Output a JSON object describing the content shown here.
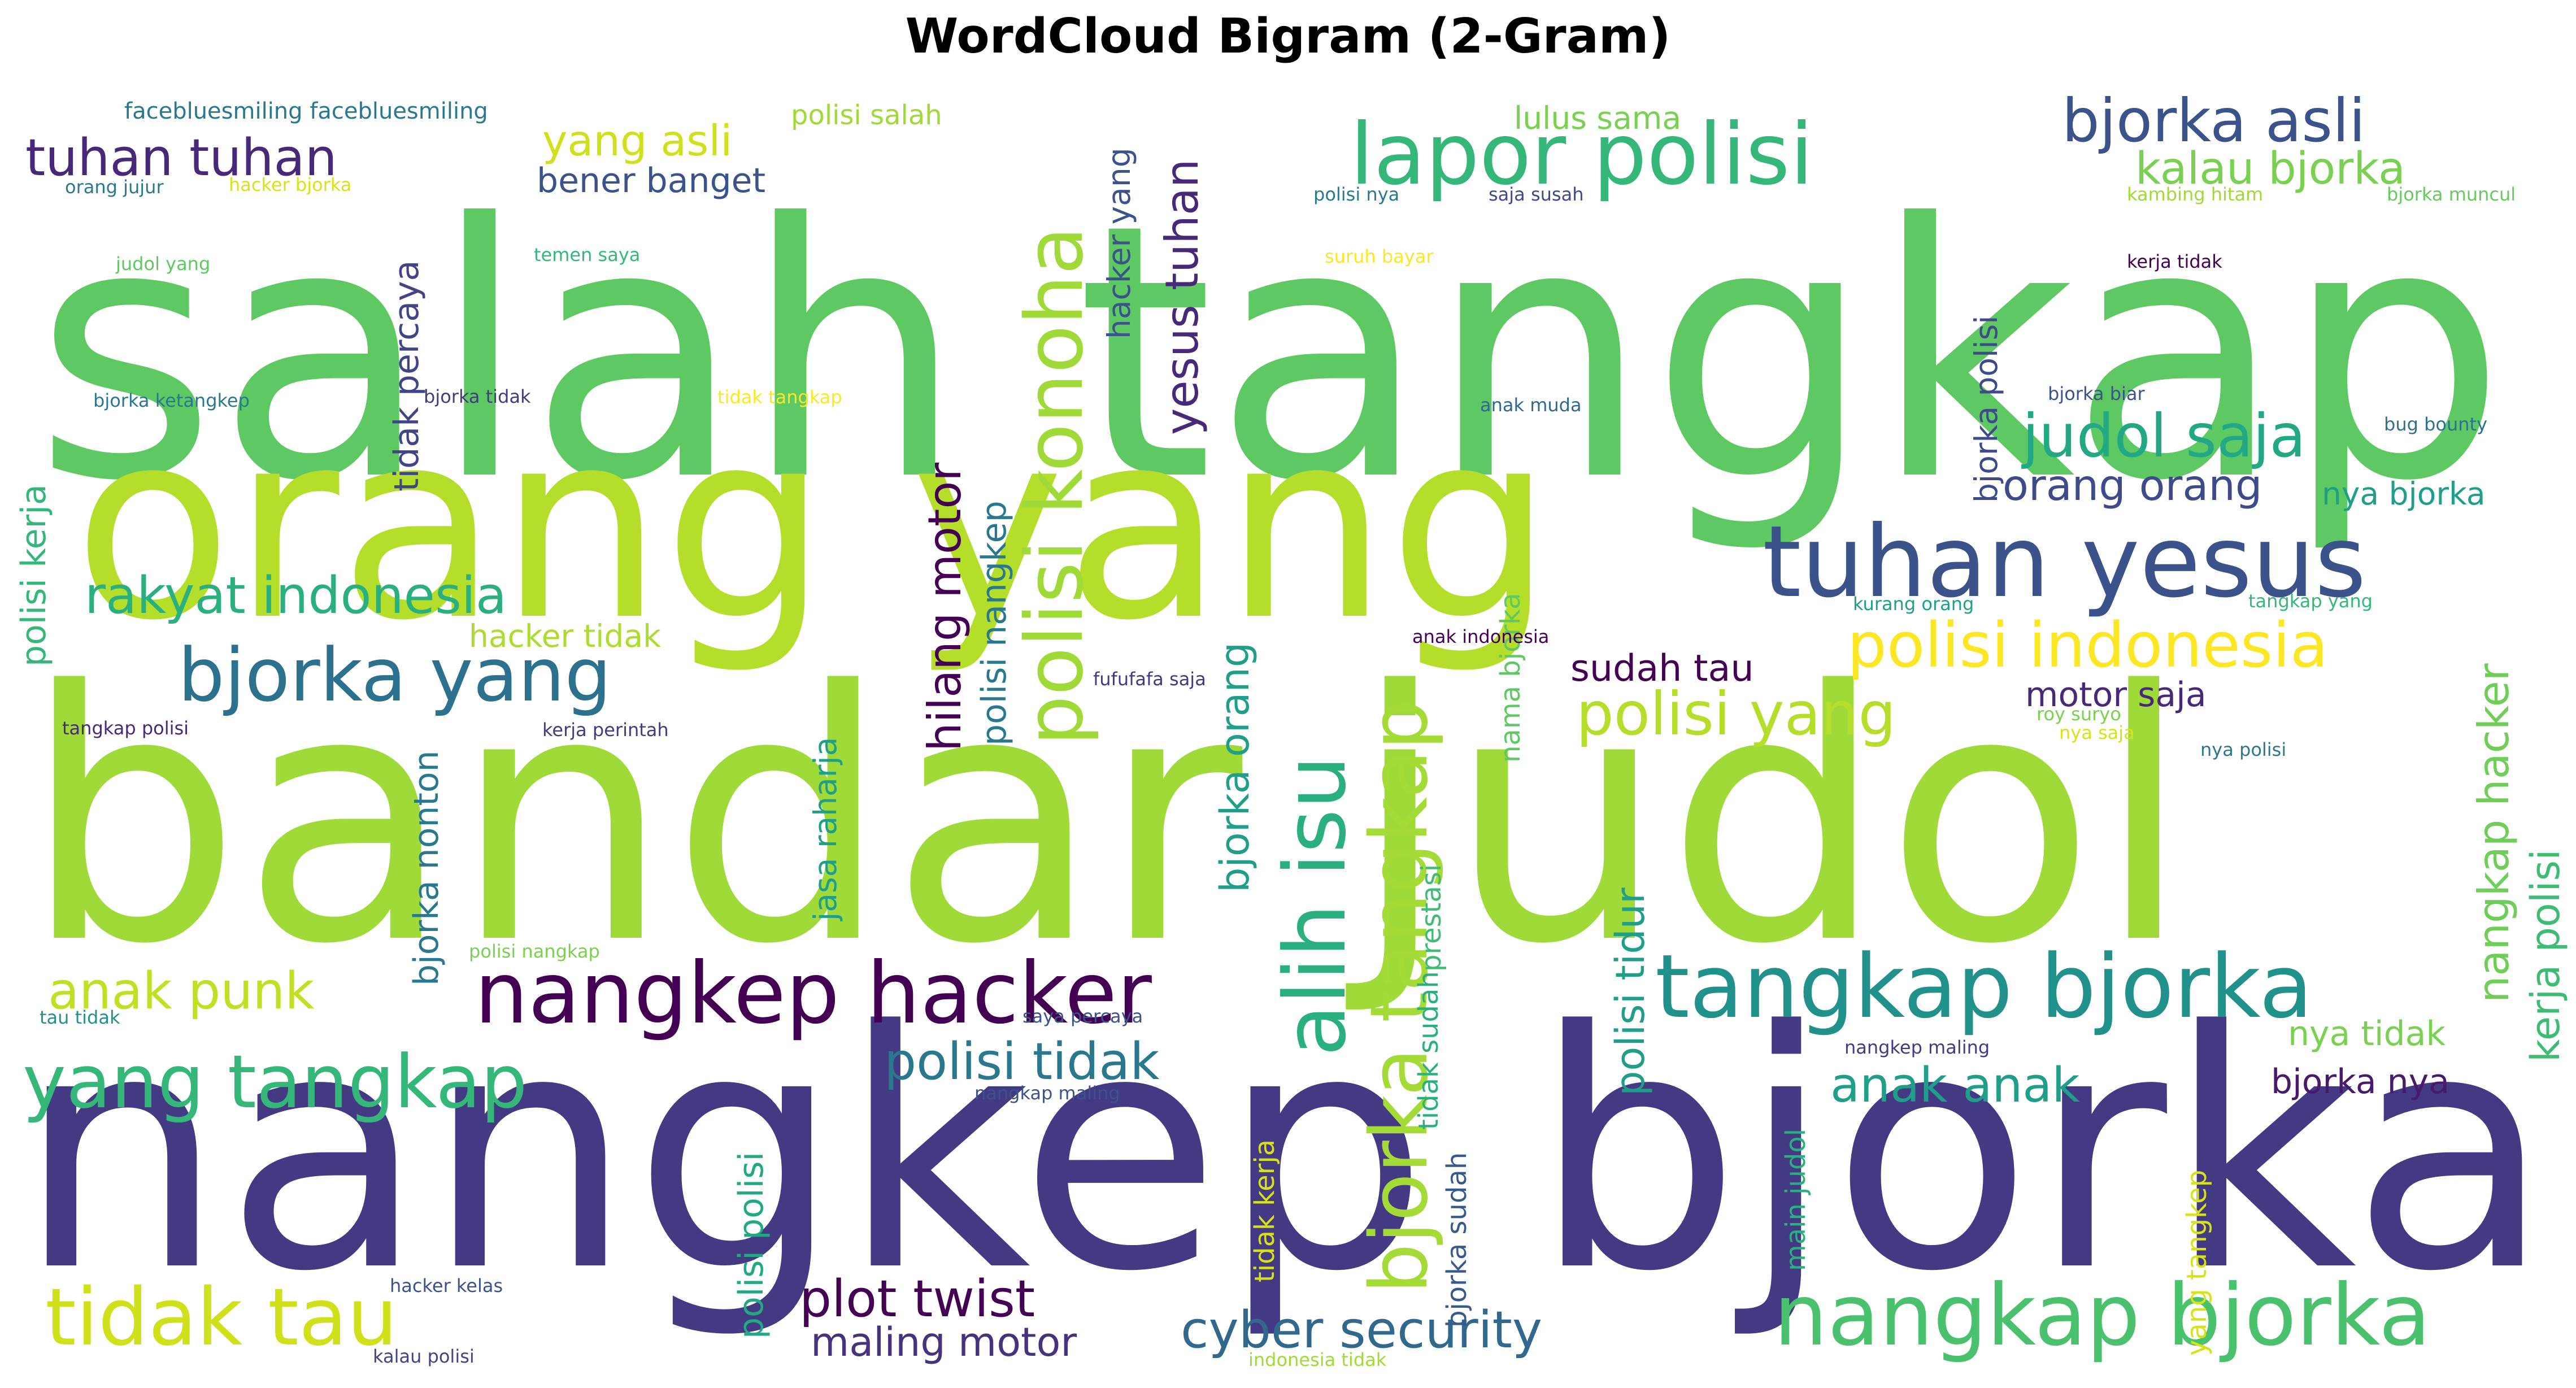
{
  "chart_data": {
    "type": "wordcloud",
    "title": "WordCloud Bigram (2-Gram)",
    "words": [
      {
        "text": "salah tangkap",
        "weight": 100,
        "color": "#5ec962",
        "angle": 0
      },
      {
        "text": "orang yang",
        "weight": 90,
        "color": "#b5de2b",
        "angle": 0
      },
      {
        "text": "bandar judol",
        "weight": 96,
        "color": "#a0da39",
        "angle": 0
      },
      {
        "text": "nangkep bjorka",
        "weight": 88,
        "color": "#443983",
        "angle": 0
      },
      {
        "text": "tuhan yesus",
        "weight": 27,
        "color": "#3b528b",
        "angle": 0
      },
      {
        "text": "lapor polisi",
        "weight": 24,
        "color": "#35b779",
        "angle": 0
      },
      {
        "text": "nangkep hacker",
        "weight": 22,
        "color": "#440154",
        "angle": 0
      },
      {
        "text": "tangkap bjorka",
        "weight": 23,
        "color": "#21918c",
        "angle": 0
      },
      {
        "text": "nangkap bjorka",
        "weight": 22,
        "color": "#4ac16d",
        "angle": 0
      },
      {
        "text": "alih isu",
        "weight": 20,
        "color": "#2ab07f",
        "angle": -90
      },
      {
        "text": "bjorka tangkap",
        "weight": 20,
        "color": "#a5db36",
        "angle": -90
      },
      {
        "text": "polisi konoha",
        "weight": 20,
        "color": "#a0da39",
        "angle": -90
      },
      {
        "text": "tidak tau",
        "weight": 21,
        "color": "#d0e11c",
        "angle": 0
      },
      {
        "text": "yang tangkap",
        "weight": 19,
        "color": "#35b779",
        "angle": 0
      },
      {
        "text": "bjorka yang",
        "weight": 19,
        "color": "#2c728e",
        "angle": 0
      },
      {
        "text": "polisi indonesia",
        "weight": 16,
        "color": "#fde725",
        "angle": 0
      },
      {
        "text": "bjorka asli",
        "weight": 14,
        "color": "#3b528b",
        "angle": 0
      },
      {
        "text": "judol saja",
        "weight": 14,
        "color": "#22a884",
        "angle": 0
      },
      {
        "text": "polisi yang",
        "weight": 15,
        "color": "#b5de2b",
        "angle": 0
      },
      {
        "text": "rakyat indonesia",
        "weight": 13,
        "color": "#2ab07f",
        "angle": 0
      },
      {
        "text": "tuhan tuhan",
        "weight": 13,
        "color": "#482878",
        "angle": 0
      },
      {
        "text": "cyber security",
        "weight": 13,
        "color": "#31688e",
        "angle": 0
      },
      {
        "text": "plot twist",
        "weight": 13,
        "color": "#440154",
        "angle": 0
      },
      {
        "text": "anak punk",
        "weight": 13,
        "color": "#c2df23",
        "angle": 0
      },
      {
        "text": "polisi tidak",
        "weight": 13,
        "color": "#2a788e",
        "angle": 0
      },
      {
        "text": "anak anak",
        "weight": 12,
        "color": "#1f9e89",
        "angle": 0
      },
      {
        "text": "hilang motor",
        "weight": 12,
        "color": "#440154",
        "angle": -90
      },
      {
        "text": "yesus tuhan",
        "weight": 12,
        "color": "#482878",
        "angle": -90
      },
      {
        "text": "kalau bjorka",
        "weight": 11,
        "color": "#7ad151",
        "angle": 0
      },
      {
        "text": "orang orang",
        "weight": 11,
        "color": "#3e4a89",
        "angle": 0
      },
      {
        "text": "yang asli",
        "weight": 11,
        "color": "#d0e11c",
        "angle": 0
      },
      {
        "text": "nangkap hacker",
        "weight": 11,
        "color": "#6ece58",
        "angle": -90
      },
      {
        "text": "kerja polisi",
        "weight": 10,
        "color": "#3fbc73",
        "angle": -90
      },
      {
        "text": "polisi tidur",
        "weight": 10,
        "color": "#1f9e89",
        "angle": -90
      },
      {
        "text": "bjorka orang",
        "weight": 10,
        "color": "#1f9e89",
        "angle": -90
      },
      {
        "text": "maling motor",
        "weight": 10,
        "color": "#46327e",
        "angle": 0
      },
      {
        "text": "sudah tau",
        "weight": 9,
        "color": "#440154",
        "angle": 0
      },
      {
        "text": "motor saja",
        "weight": 9,
        "color": "#482878",
        "angle": 0
      },
      {
        "text": "bjorka nya",
        "weight": 9,
        "color": "#481a6c",
        "angle": 0
      },
      {
        "text": "nya tidak",
        "weight": 9,
        "color": "#7ad151",
        "angle": 0
      },
      {
        "text": "bener banget",
        "weight": 9,
        "color": "#3b528b",
        "angle": 0
      },
      {
        "text": "bjorka nonton",
        "weight": 9,
        "color": "#2a788e",
        "angle": -90
      },
      {
        "text": "tidak percaya",
        "weight": 9,
        "color": "#414487",
        "angle": -90
      },
      {
        "text": "polisi kerja",
        "weight": 9,
        "color": "#35b779",
        "angle": -90
      },
      {
        "text": "polisi polisi",
        "weight": 9,
        "color": "#22a884",
        "angle": -90
      },
      {
        "text": "polisi nangkep",
        "weight": 9,
        "color": "#2a788e",
        "angle": -90
      },
      {
        "text": "jasa raharja",
        "weight": 8,
        "color": "#1f9e89",
        "angle": -90
      },
      {
        "text": "hacker yang",
        "weight": 8,
        "color": "#3b528b",
        "angle": -90
      },
      {
        "text": "bjorka polisi",
        "weight": 8,
        "color": "#3e4a89",
        "angle": -90
      },
      {
        "text": "hacker tidak",
        "weight": 8,
        "color": "#addc30",
        "angle": 0
      },
      {
        "text": "lulus sama",
        "weight": 8,
        "color": "#7ad151",
        "angle": 0
      },
      {
        "text": "nya bjorka",
        "weight": 8,
        "color": "#1f9e89",
        "angle": 0
      },
      {
        "text": "polisi salah",
        "weight": 8,
        "color": "#a0da39",
        "angle": 0
      },
      {
        "text": "tidak kerja",
        "weight": 7,
        "color": "#d8e219",
        "angle": -90
      },
      {
        "text": "yang tangkep",
        "weight": 7,
        "color": "#d8e219",
        "angle": -90
      },
      {
        "text": "main judol",
        "weight": 7,
        "color": "#2ab07f",
        "angle": -90
      },
      {
        "text": "bjorka sudah",
        "weight": 7,
        "color": "#38598c",
        "angle": -90
      },
      {
        "text": "tidak sudah",
        "weight": 7,
        "color": "#2ab07f",
        "angle": -90
      },
      {
        "text": "nama bjorka",
        "weight": 7,
        "color": "#5ec962",
        "angle": -90
      },
      {
        "text": "prestasi",
        "weight": 6,
        "color": "#3fbc73",
        "angle": -90
      },
      {
        "text": "facebluesmiling facebluesmiling",
        "weight": 5,
        "color": "#2a788e",
        "angle": 0
      },
      {
        "text": "hacker bjorka",
        "weight": 4,
        "color": "#d8e219",
        "angle": 0
      },
      {
        "text": "orang jujur",
        "weight": 4,
        "color": "#2a788e",
        "angle": 0
      },
      {
        "text": "judol yang",
        "weight": 4,
        "color": "#5ec962",
        "angle": 0
      },
      {
        "text": "temen saya",
        "weight": 4,
        "color": "#35b779",
        "angle": 0
      },
      {
        "text": "bjorka ketangkep",
        "weight": 4,
        "color": "#2a788e",
        "angle": 0
      },
      {
        "text": "bjorka tidak",
        "weight": 4,
        "color": "#443983",
        "angle": 0
      },
      {
        "text": "tidak tangkap",
        "weight": 4,
        "color": "#fde725",
        "angle": 0
      },
      {
        "text": "tangkap polisi",
        "weight": 4,
        "color": "#482878",
        "angle": 0
      },
      {
        "text": "kerja perintah",
        "weight": 4,
        "color": "#443983",
        "angle": 0
      },
      {
        "text": "polisi nangkap",
        "weight": 4,
        "color": "#7ad151",
        "angle": 0
      },
      {
        "text": "tau tidak",
        "weight": 4,
        "color": "#21918c",
        "angle": 0
      },
      {
        "text": "hacker kelas",
        "weight": 4,
        "color": "#3b528b",
        "angle": 0
      },
      {
        "text": "kalau polisi",
        "weight": 4,
        "color": "#414487",
        "angle": 0
      },
      {
        "text": "polisi nya",
        "weight": 4,
        "color": "#2a788e",
        "angle": 0
      },
      {
        "text": "saja susah",
        "weight": 4,
        "color": "#3e4a89",
        "angle": 0
      },
      {
        "text": "suruh bayar",
        "weight": 4,
        "color": "#fde725",
        "angle": 0
      },
      {
        "text": "anak muda",
        "weight": 4,
        "color": "#31688e",
        "angle": 0
      },
      {
        "text": "kambing hitam",
        "weight": 4,
        "color": "#a0da39",
        "angle": 0
      },
      {
        "text": "bjorka muncul",
        "weight": 4,
        "color": "#65cb5e",
        "angle": 0
      },
      {
        "text": "kerja tidak",
        "weight": 4,
        "color": "#440154",
        "angle": 0
      },
      {
        "text": "bjorka biar",
        "weight": 4,
        "color": "#3b528b",
        "angle": 0
      },
      {
        "text": "bug bounty",
        "weight": 4,
        "color": "#2c728e",
        "angle": 0
      },
      {
        "text": "anak indonesia",
        "weight": 4,
        "color": "#440154",
        "angle": 0
      },
      {
        "text": "kurang orang",
        "weight": 4,
        "color": "#1f9e89",
        "angle": 0
      },
      {
        "text": "tangkap yang",
        "weight": 4,
        "color": "#35b779",
        "angle": 0
      },
      {
        "text": "fufufafa saja",
        "weight": 4,
        "color": "#443983",
        "angle": 0
      },
      {
        "text": "roy suryo",
        "weight": 4,
        "color": "#7ad151",
        "angle": 0
      },
      {
        "text": "nya saja",
        "weight": 4,
        "color": "#d8e219",
        "angle": 0
      },
      {
        "text": "nya polisi",
        "weight": 4,
        "color": "#2a788e",
        "angle": 0
      },
      {
        "text": "saya percaya",
        "weight": 4,
        "color": "#3b528b",
        "angle": 0
      },
      {
        "text": "nangkap maling",
        "weight": 4,
        "color": "#3b528b",
        "angle": 0
      },
      {
        "text": "nangkep maling",
        "weight": 4,
        "color": "#443983",
        "angle": 0
      },
      {
        "text": "indonesia tidak",
        "weight": 4,
        "color": "#a0da39",
        "angle": 0
      }
    ]
  }
}
